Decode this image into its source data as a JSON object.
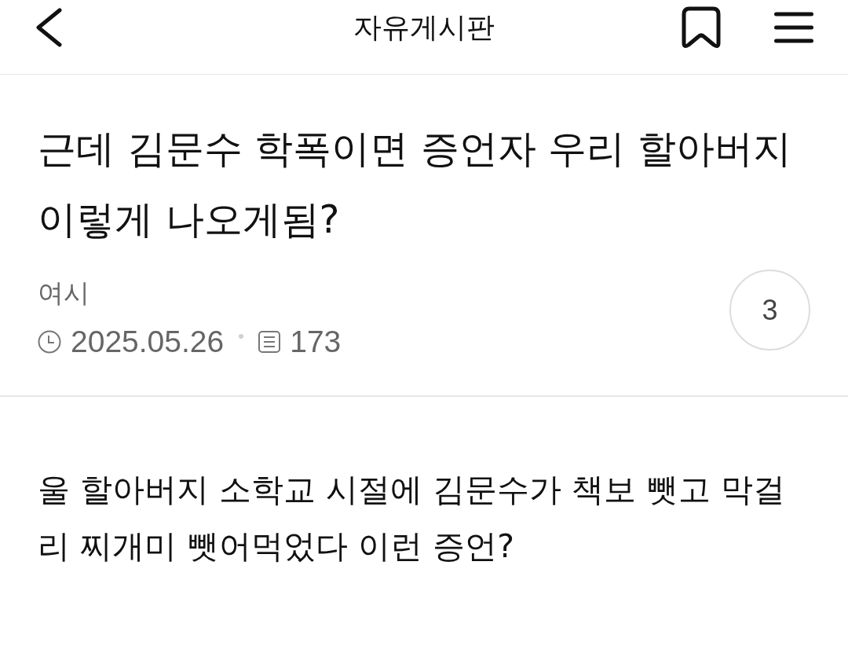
{
  "header": {
    "title": "자유게시판"
  },
  "post": {
    "title": "근데 김문수 학폭이면 증언자 우리 할아버지 이렇게 나오게됨?",
    "author": "여시",
    "date": "2025.05.26",
    "views": "173",
    "comment_count": "3"
  },
  "body": {
    "text": "울 할아버지 소학교 시절에 김문수가 책보 뺏고 막걸리 찌개미 뺏어먹었다 이런 증언?"
  }
}
